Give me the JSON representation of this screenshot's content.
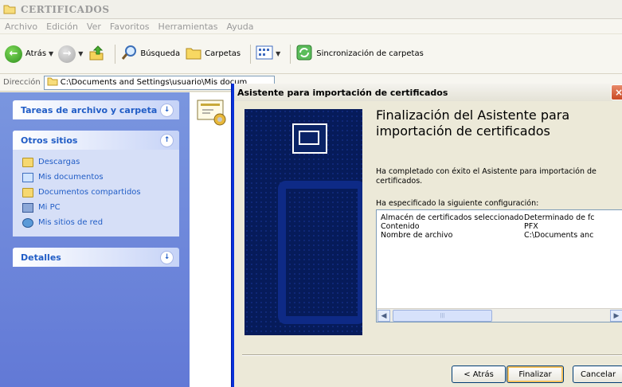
{
  "window": {
    "title": "CERTIFICADOS"
  },
  "menu": [
    "Archivo",
    "Edición",
    "Ver",
    "Favoritos",
    "Herramientas",
    "Ayuda"
  ],
  "toolbar": {
    "back_label": "Atrás",
    "search_label": "Búsqueda",
    "folders_label": "Carpetas",
    "sync_label": "Sincronización de carpetas"
  },
  "address": {
    "label": "Dirección",
    "value": "C:\\Documents and Settings\\usuario\\Mis docum"
  },
  "taskpane": {
    "file_tasks_title": "Tareas de archivo y carpeta",
    "other_places_title": "Otros sitios",
    "other_places": [
      "Descargas",
      "Mis documentos",
      "Documentos compartidos",
      "Mi PC",
      "Mis sitios de red"
    ],
    "details_title": "Detalles"
  },
  "dialog": {
    "title": "Asistente para importación de certificados",
    "heading": "Finalización del Asistente para importación de certificados",
    "completed_text": "Ha completado con éxito el Asistente para importación de certificados.",
    "config_label": "Ha especificado la siguiente configuración:",
    "settings": [
      {
        "name": "Almacén de certificados seleccionado",
        "value": "Determinado de fc"
      },
      {
        "name": "Contenido",
        "value": "PFX"
      },
      {
        "name": "Nombre de archivo",
        "value": "C:\\Documents anc"
      }
    ],
    "back_button": "< Atrás",
    "finish_button": "Finalizar",
    "cancel_button": "Cancelar"
  },
  "colors": {
    "xp_blue": "#0831d9",
    "taskpane_link": "#215dc6",
    "banner_navy": "#061b5a"
  }
}
